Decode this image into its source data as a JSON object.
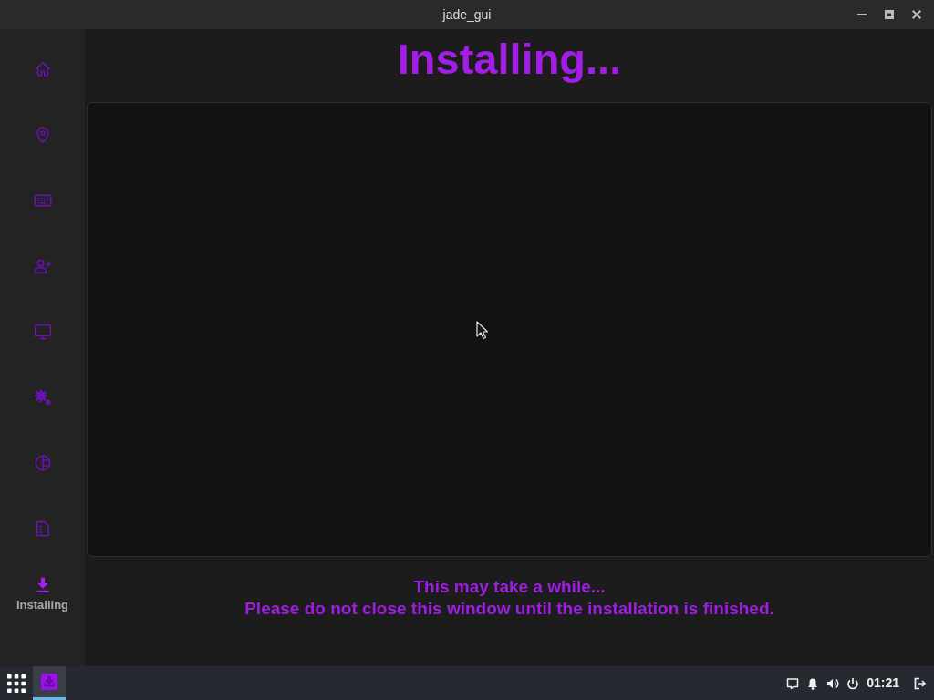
{
  "window": {
    "title": "jade_gui"
  },
  "sidebar": {
    "items": [
      {
        "selected": false
      },
      {
        "selected": false
      },
      {
        "selected": false
      },
      {
        "selected": false
      },
      {
        "selected": false
      },
      {
        "selected": false
      },
      {
        "selected": false
      },
      {
        "selected": false
      },
      {
        "label": "Installing",
        "selected": true
      }
    ]
  },
  "page": {
    "heading": "Installing...",
    "messages": [
      "This may take a while...",
      "Please do not close this window until the installation is finished."
    ]
  },
  "taskbar": {
    "apps": [
      {
        "selected": true
      }
    ],
    "clock": "01:21"
  }
}
